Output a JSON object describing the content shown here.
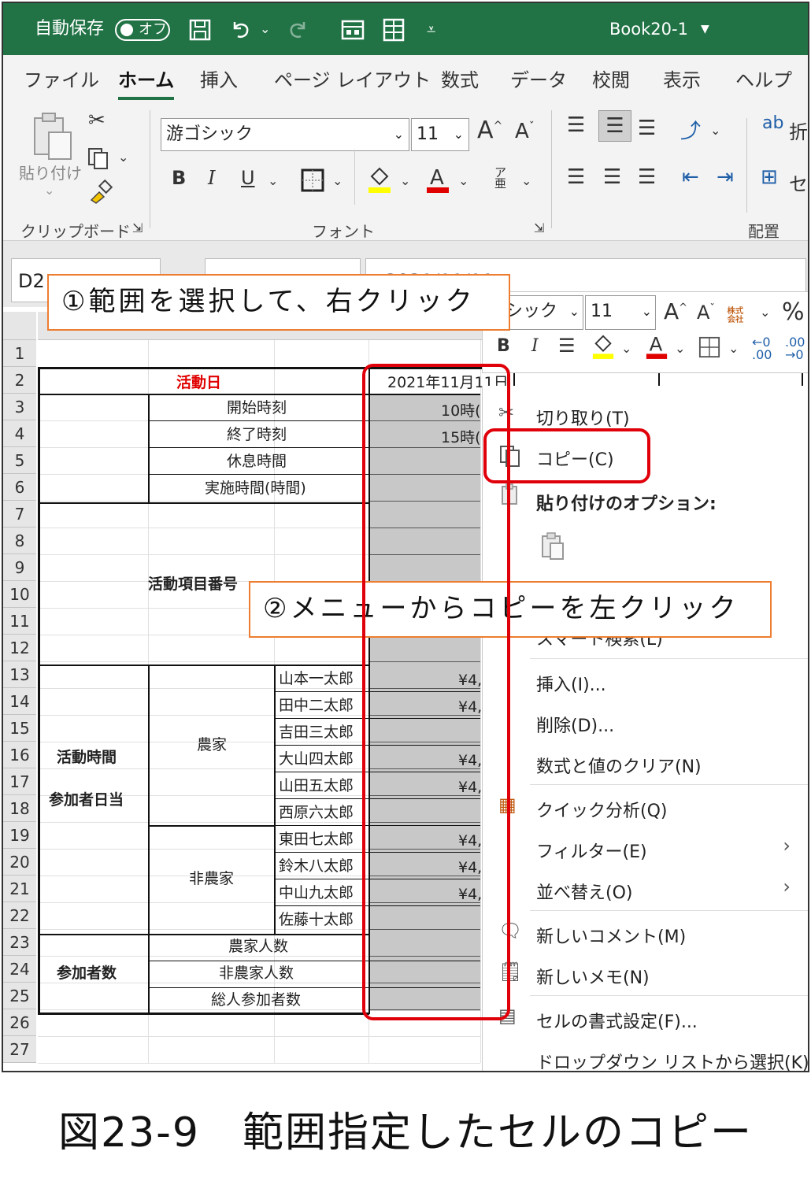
{
  "titlebar": {
    "autosave_label": "自動保存",
    "autosave_state": "オフ",
    "book_title": "Book20-1"
  },
  "tabs": [
    "ファイル",
    "ホーム",
    "挿入",
    "ページ レイアウト",
    "数式",
    "データ",
    "校閲",
    "表示",
    "ヘルプ"
  ],
  "ribbon": {
    "paste_label": "貼り付け",
    "clipboard_group": "クリップボード",
    "font_name": "游ゴシック",
    "font_size": "11",
    "font_group": "フォント",
    "align_group": "配置",
    "wrap_label": "折",
    "merge_label": "セ"
  },
  "formula_bar": {
    "name_box": "D2",
    "formula": "2021/11/11"
  },
  "mini_toolbar": {
    "font_name": "ゴシック",
    "font_size": "11",
    "percent": "%"
  },
  "row_numbers": [
    "1",
    "2",
    "3",
    "4",
    "5",
    "6",
    "7",
    "8",
    "9",
    "10",
    "11",
    "12",
    "13",
    "14",
    "15",
    "16",
    "17",
    "18",
    "19",
    "20",
    "21",
    "22",
    "23",
    "24",
    "25",
    "26",
    "27"
  ],
  "sheet": {
    "activity_day": "活動日",
    "date_value": "2021年11月11日",
    "activity_time": "活動時間",
    "start_time": "開始時刻",
    "end_time": "終了時刻",
    "break_time": "休息時間",
    "work_hours": "実施時間(時間)",
    "start_value": "10時(",
    "end_value": "15時(",
    "item_number": "活動項目番号",
    "participant_pay": "参加者日当",
    "farmer": "農家",
    "non_farmer": "非農家",
    "names": [
      "山本一太郎",
      "田中二太郎",
      "吉田三太郎",
      "大山四太郎",
      "山田五太郎",
      "西原六太郎",
      "東田七太郎",
      "鈴木八太郎",
      "中山九太郎",
      "佐藤十太郎"
    ],
    "pay_values": [
      "¥4,",
      "¥4,",
      "",
      "¥4,",
      "¥4,",
      "",
      "¥4,",
      "¥4,",
      "¥4,",
      ""
    ],
    "participants": "参加者数",
    "farmer_count": "農家人数",
    "non_farmer_count": "非農家人数",
    "total_count": "総人参加者数"
  },
  "context_menu": {
    "cut": "切り取り(T)",
    "copy": "コピー(C)",
    "paste_options": "貼り付けのオプション:",
    "smart_lookup": "スマート検索(L)",
    "insert": "挿入(I)...",
    "delete": "削除(D)...",
    "clear": "数式と値のクリア(N)",
    "quick_analysis": "クイック分析(Q)",
    "filter": "フィルター(E)",
    "sort": "並べ替え(O)",
    "new_comment": "新しいコメント(M)",
    "new_note": "新しいメモ(N)",
    "format_cells": "セルの書式設定(F)...",
    "dropdown_pick": "ドロップダウン リストから選択(K)..."
  },
  "annotations": {
    "step1": "①範囲を選択して、右クリック",
    "step2": "②メニューからコピーを左クリック"
  },
  "caption": "図23-9　範囲指定したセルのコピー"
}
